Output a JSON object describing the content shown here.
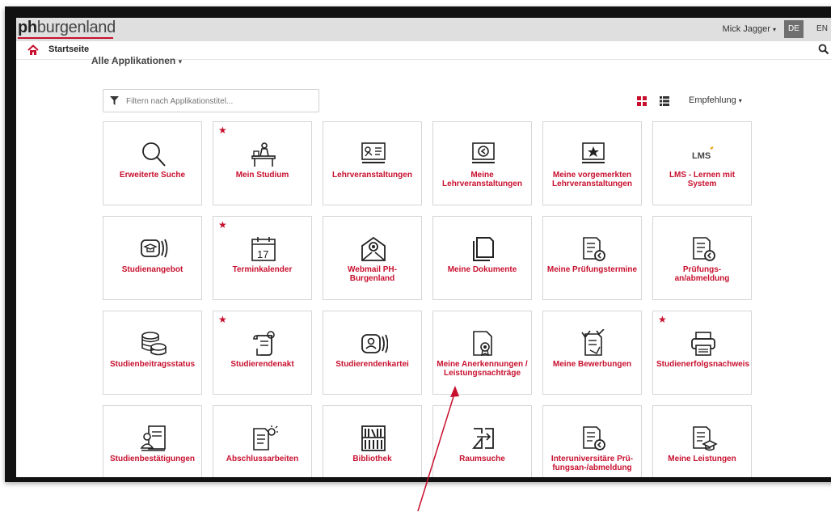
{
  "header": {
    "logo_bold": "ph",
    "logo_rest": "burgenland",
    "user_name": "Mick Jagger",
    "lang_de": "DE",
    "lang_en": "EN"
  },
  "nav": {
    "home_label": "Startseite"
  },
  "section_title": "Alle Applikationen",
  "filter": {
    "placeholder": "Filtern nach Applikationstitel..."
  },
  "sort_label": "Empfehlung",
  "colors": {
    "accent": "#c8102e",
    "topbar": "#dfdfdf",
    "frame": "#111111"
  },
  "tiles": [
    {
      "label": "Erweiterte Suche",
      "icon": "magnifier-icon",
      "starred": false
    },
    {
      "label": "Mein Studium",
      "icon": "student-desk-icon",
      "starred": true
    },
    {
      "label": "Lehrveranstaltungen",
      "icon": "presentation-board-icon",
      "starred": false
    },
    {
      "label": "Meine Lehrveranstaltungen",
      "icon": "board-arrow-icon",
      "starred": false
    },
    {
      "label": "Meine vorgemerkten Lehrveranstaltungen",
      "icon": "board-star-icon",
      "starred": false
    },
    {
      "label": "LMS - Lernen mit System",
      "icon": "lms-logo-icon",
      "starred": false
    },
    {
      "label": "Studienangebot",
      "icon": "graduation-card-icon",
      "starred": false
    },
    {
      "label": "Terminkalender",
      "icon": "calendar-icon",
      "starred": true
    },
    {
      "label": "Webmail PH-Burgenland",
      "icon": "webmail-icon",
      "starred": false
    },
    {
      "label": "Meine Dokumente",
      "icon": "documents-icon",
      "starred": false
    },
    {
      "label": "Meine Prüfungstermine",
      "icon": "exam-dates-icon",
      "starred": false
    },
    {
      "label": "Prüfungs-an/abmeldung",
      "icon": "exam-registration-icon",
      "starred": false
    },
    {
      "label": "Studienbeitragsstatus",
      "icon": "coins-icon",
      "starred": false
    },
    {
      "label": "Studierendenakt",
      "icon": "scroll-icon",
      "starred": true
    },
    {
      "label": "Studierendenkartei",
      "icon": "id-card-icon",
      "starred": false
    },
    {
      "label": "Meine Anerkennungen / Leistungsnachträge",
      "icon": "certificate-file-icon",
      "starred": false
    },
    {
      "label": "Meine Bewerbungen",
      "icon": "application-icon",
      "starred": false
    },
    {
      "label": "Studienerfolgsnachweis",
      "icon": "printer-icon",
      "starred": true
    },
    {
      "label": "Studienbestätigungen",
      "icon": "confirmation-icon",
      "starred": false
    },
    {
      "label": "Abschlussarbeiten",
      "icon": "thesis-icon",
      "starred": false
    },
    {
      "label": "Bibliothek",
      "icon": "library-icon",
      "starred": false
    },
    {
      "label": "Raumsuche",
      "icon": "room-search-icon",
      "starred": false
    },
    {
      "label": "Interuniversitäre Prü-fungsan-/abmeldung",
      "icon": "interuniversity-exam-icon",
      "starred": false
    },
    {
      "label": "Meine Leistungen",
      "icon": "achievements-icon",
      "starred": false
    }
  ]
}
